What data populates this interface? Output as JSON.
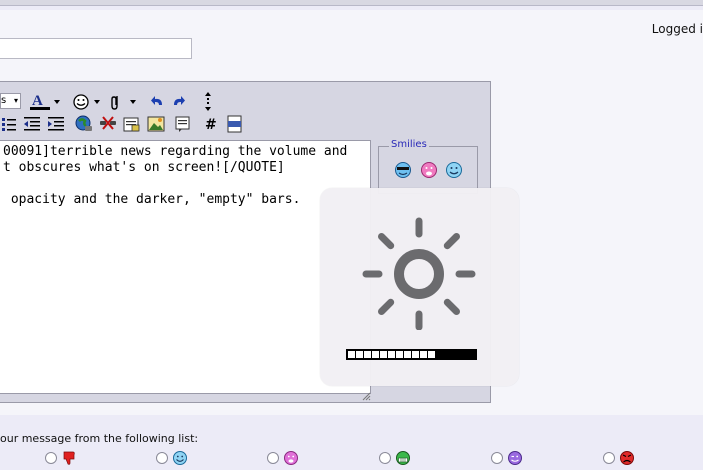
{
  "header": {
    "logged_in_text": "Logged i"
  },
  "editor": {
    "message_lines": [
      "00091]terrible news regarding the volume and",
      "t obscures what's on screen![/QUOTE]",
      "",
      " opacity and the darker, \"empty\" bars."
    ],
    "smilies_legend": "Smilies",
    "font_select_value": "s"
  },
  "post_icons": {
    "label": "our message from the following list:",
    "icons": [
      "thumbs-down-icon",
      "smile-icon",
      "tongue-icon",
      "grin-icon",
      "wink-icon",
      "angry-icon"
    ]
  },
  "osd": {
    "icon": "brightness-sun-icon",
    "level_segments_total": 16,
    "level_segments_filled": 11
  },
  "colors": {
    "accent": "#2a2ab8",
    "editor_bg": "#d6d6e2",
    "page_bg": "#ecebf7"
  }
}
